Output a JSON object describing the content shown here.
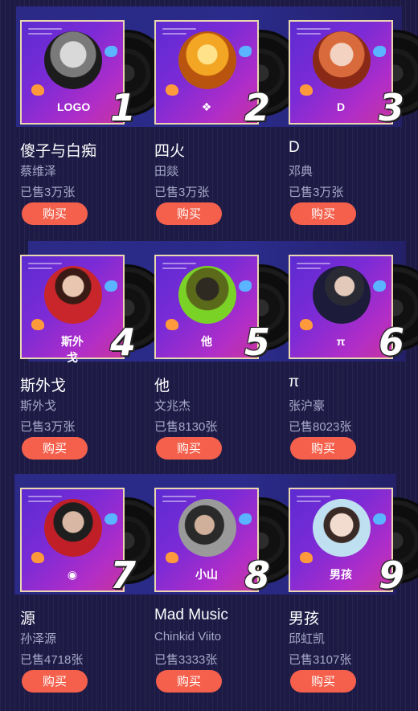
{
  "albums": [
    {
      "rank": "1",
      "title": "傻子与白痴",
      "artist": "蔡维泽",
      "sold": "已售3万张",
      "buy_label": "购买",
      "logo": "LOGO",
      "photo": "portrait-bw"
    },
    {
      "rank": "2",
      "title": "四火",
      "artist": "田燚",
      "sold": "已售3万张",
      "buy_label": "购买",
      "logo": "❖",
      "photo": "portrait-fire"
    },
    {
      "rank": "3",
      "title": "D",
      "artist": "邓典",
      "sold": "已售3万张",
      "buy_label": "购买",
      "logo": "D",
      "photo": "portrait-red"
    },
    {
      "rank": "4",
      "title": "斯外戈",
      "artist": "斯外戈",
      "sold": "已售3万张",
      "buy_label": "购买",
      "logo": "斯外戈",
      "photo": "portrait-redjacket"
    },
    {
      "rank": "5",
      "title": "他",
      "artist": "文兆杰",
      "sold": "已售8130张",
      "buy_label": "购买",
      "logo": "他",
      "photo": "portrait-green"
    },
    {
      "rank": "6",
      "title": "π",
      "artist": "张沪豪",
      "sold": "已售8023张",
      "buy_label": "购买",
      "logo": "π",
      "photo": "portrait-dark"
    },
    {
      "rank": "7",
      "title": "源",
      "artist": "孙泽源",
      "sold": "已售4718张",
      "buy_label": "购买",
      "logo": "◉",
      "photo": "portrait-black"
    },
    {
      "rank": "8",
      "title": "Mad Music",
      "artist": "Chinkid Viito",
      "sold": "已售3333张",
      "buy_label": "购买",
      "logo": "小山",
      "photo": "portrait-hat"
    },
    {
      "rank": "9",
      "title": "男孩",
      "artist": "邱虹凯",
      "sold": "已售3107张",
      "buy_label": "购买",
      "logo": "男孩",
      "photo": "portrait-light"
    }
  ],
  "colors": {
    "accent": "#f4604c",
    "background": "#1d1a45",
    "band": "#2b2a86"
  }
}
